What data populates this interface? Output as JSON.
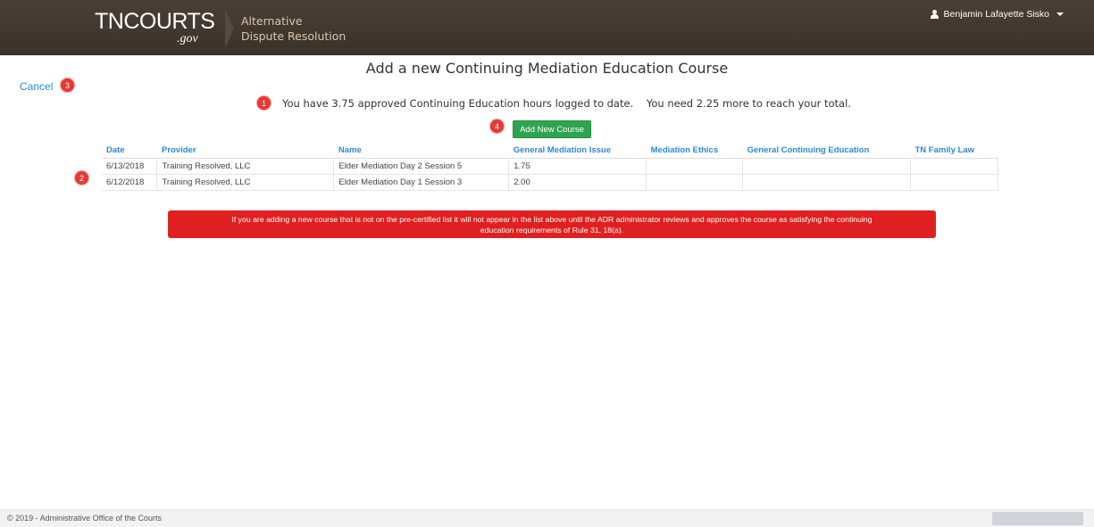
{
  "header": {
    "logo_main": "TNCOURTS",
    "logo_sub": ".gov",
    "app_title_line1": "Alternative",
    "app_title_line2": "Dispute Resolution",
    "user_name": "Benjamin Lafayette Sisko",
    "colors": {
      "background": "#3f352d",
      "title": "#d9c8b0"
    }
  },
  "page": {
    "cancel_label": "Cancel",
    "title": "Add a new Continuing Mediation Education Course",
    "hours_message": "You have 3.75 approved Continuing Education hours logged to date.    You need 2.25 more to reach your total.",
    "add_button_label": "Add New Course",
    "markers": [
      "1",
      "2",
      "3",
      "4"
    ]
  },
  "table": {
    "columns": [
      "Date",
      "Provider",
      "Name",
      "General Mediation Issue",
      "Mediation Ethics",
      "General Continuing Education",
      "TN Family Law"
    ],
    "rows": [
      [
        "6/13/2018",
        "Training Resolved, LLC",
        "Elder Mediation Day 2 Session 5",
        "1.75",
        "",
        "",
        ""
      ],
      [
        "6/12/2018",
        "Training Resolved, LLC",
        "Elder Mediation Day 1 Session 3",
        "2.00",
        "",
        "",
        ""
      ]
    ]
  },
  "alert": {
    "line1": "If you are adding a new course that is not on the pre-certified list it will not appear in the list above until the ADR administrator reviews and approves the course as satisfying the continuing",
    "line2": "education requirements of Rule 31, 18(a).",
    "color": "#e02020"
  },
  "footer": {
    "text": "© 2019 - Administrative Office of the Courts"
  }
}
